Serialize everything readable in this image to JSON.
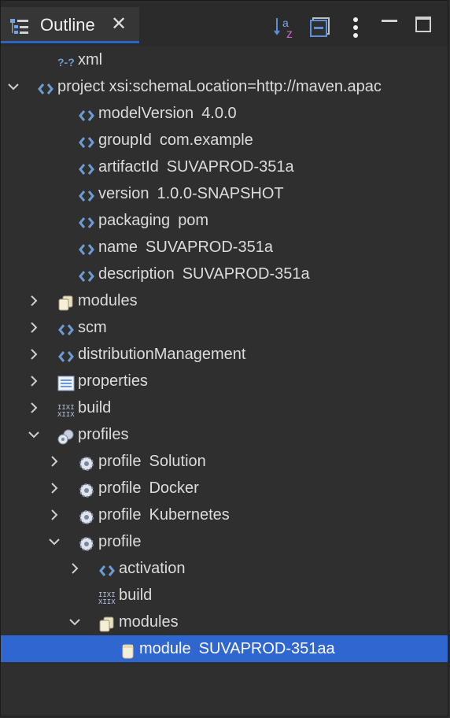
{
  "tab": {
    "label": "Outline",
    "close": "✕"
  },
  "tree": [
    {
      "label": "xml",
      "value": "",
      "icon": "xml-decl-icon",
      "expander": "none"
    },
    {
      "label": "project xsi:schemaLocation=http://maven.apac",
      "value": "",
      "icon": "element-icon",
      "expander": "expanded"
    },
    {
      "label": "modelVersion",
      "value": "4.0.0",
      "icon": "element-icon",
      "expander": "none"
    },
    {
      "label": "groupId",
      "value": "com.example",
      "icon": "element-icon",
      "expander": "none"
    },
    {
      "label": "artifactId",
      "value": "SUVAPROD-351a",
      "icon": "element-icon",
      "expander": "none"
    },
    {
      "label": "version",
      "value": "1.0.0-SNAPSHOT",
      "icon": "element-icon",
      "expander": "none"
    },
    {
      "label": "packaging",
      "value": "pom",
      "icon": "element-icon",
      "expander": "none"
    },
    {
      "label": "name",
      "value": "SUVAPROD-351a",
      "icon": "element-icon",
      "expander": "none"
    },
    {
      "label": "description",
      "value": "SUVAPROD-351a",
      "icon": "element-icon",
      "expander": "none"
    },
    {
      "label": "modules",
      "value": "",
      "icon": "modules-icon",
      "expander": "collapsed"
    },
    {
      "label": "scm",
      "value": "",
      "icon": "element-icon",
      "expander": "collapsed"
    },
    {
      "label": "distributionManagement",
      "value": "",
      "icon": "element-icon",
      "expander": "collapsed"
    },
    {
      "label": "properties",
      "value": "",
      "icon": "properties-icon",
      "expander": "collapsed"
    },
    {
      "label": "build",
      "value": "",
      "icon": "build-icon",
      "expander": "collapsed"
    },
    {
      "label": "profiles",
      "value": "",
      "icon": "profiles-icon",
      "expander": "expanded"
    },
    {
      "label": "profile",
      "value": "Solution",
      "icon": "profile-icon",
      "expander": "collapsed"
    },
    {
      "label": "profile",
      "value": "Docker",
      "icon": "profile-icon",
      "expander": "collapsed"
    },
    {
      "label": "profile",
      "value": "Kubernetes",
      "icon": "profile-icon",
      "expander": "collapsed"
    },
    {
      "label": "profile",
      "value": "",
      "icon": "profile-icon",
      "expander": "expanded"
    },
    {
      "label": "activation",
      "value": "",
      "icon": "element-icon",
      "expander": "collapsed"
    },
    {
      "label": "build",
      "value": "",
      "icon": "build-icon",
      "expander": "none"
    },
    {
      "label": "modules",
      "value": "",
      "icon": "modules-icon",
      "expander": "expanded"
    },
    {
      "label": "module",
      "value": "SUVAPROD-351aa",
      "icon": "module-icon",
      "expander": "none",
      "selected": true
    }
  ]
}
